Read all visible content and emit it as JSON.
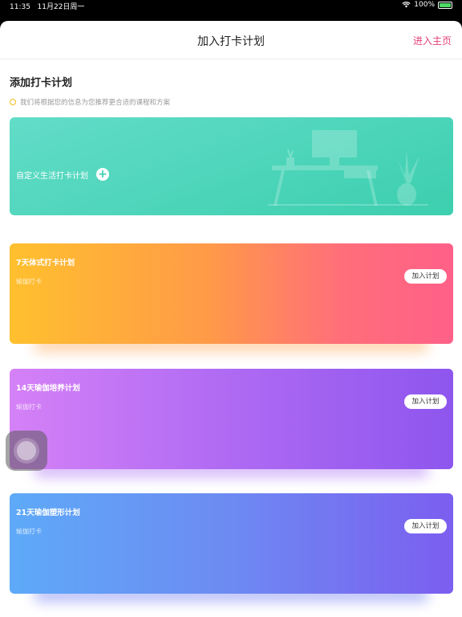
{
  "statusbar": {
    "time": "11:35",
    "date": "11月22日周一",
    "battery": "100%"
  },
  "navbar": {
    "title": "加入打卡计划",
    "action": "进入主页"
  },
  "section": {
    "title": "添加打卡计划",
    "hint": "我们将根据您的信息为您推荐更合适的课程和方案"
  },
  "custom_card": {
    "label": "自定义生活打卡计划",
    "plus": "+"
  },
  "plans": [
    {
      "title": "7天体式打卡计划",
      "subtitle": "瑜伽打卡",
      "button": "加入计划"
    },
    {
      "title": "14天瑜伽培养计划",
      "subtitle": "瑜伽打卡",
      "button": "加入计划"
    },
    {
      "title": "21天瑜伽塑形计划",
      "subtitle": "瑜伽打卡",
      "button": "加入计划"
    }
  ],
  "icons": {
    "wifi": "wifi-icon",
    "battery": "battery-icon",
    "plus": "plus-icon",
    "assistive": "assistive-touch-icon"
  },
  "colors": {
    "accent": "#e5427a",
    "teal": "#3ccfae",
    "hint_dot": "#f3b81b"
  }
}
